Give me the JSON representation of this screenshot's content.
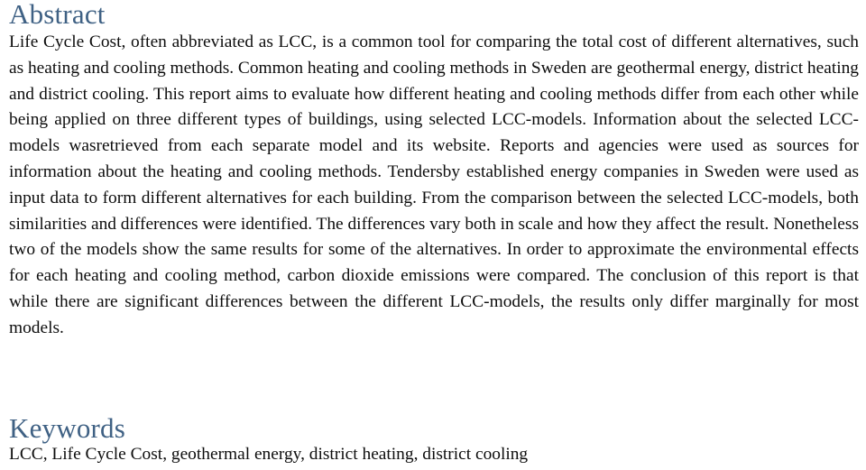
{
  "document": {
    "type": "academic-paper-abstract-page",
    "background_color": "#ffffff",
    "heading_color": "#3f6184",
    "body_text_color": "#0d0d0d"
  },
  "abstract": {
    "heading": "Abstract",
    "body": "Life Cycle Cost, often abbreviated as LCC, is a common tool for comparing the total cost of different alternatives, such as heating and cooling methods. Common heating and cooling methods in Sweden are geothermal energy, district heating and district cooling. This report aims to evaluate how different heating and cooling methods differ from each other while being applied on three different types of buildings, using selected LCC-models. Information about the selected LCC-models wasretrieved from each separate model and its website. Reports and agencies were used as sources for information about the heating and cooling methods. Tendersby established energy companies in Sweden were used as input data to form different alternatives for each building. From the comparison between the selected LCC-models, both similarities and differences were identified. The differences vary both in scale and how they affect the result. Nonetheless two of the models show the same results for some of the alternatives. In order to approximate the environmental effects for each heating and cooling method, carbon dioxide emissions were compared. The conclusion of this report is that while there are significant differences between the different LCC-models, the results only differ marginally for most models."
  },
  "keywords": {
    "heading": "Keywords",
    "body": "LCC, Life Cycle Cost, geothermal energy, district heating, district cooling",
    "terms": [
      "LCC",
      "Life Cycle Cost",
      "geothermal energy",
      "district heating",
      "district cooling"
    ]
  }
}
